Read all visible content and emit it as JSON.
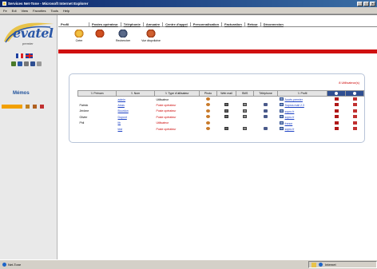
{
  "window": {
    "title": "Services Net-Tone - Microsoft Internet Explorer"
  },
  "menu": [
    "Fe",
    "Edi",
    "View",
    "Favorites",
    "Tools",
    "Help"
  ],
  "brand": {
    "logo_text": "evatel",
    "sub_text": "premier"
  },
  "sidebar": {
    "memos_title": "Mémos"
  },
  "nav": {
    "current": "Profil",
    "tabs": [
      "Postes opérateur",
      "Téléphonie",
      "Annuaire",
      "Centre d'appel",
      "Personnalisation",
      "Facturation",
      "Retour",
      "Déconnexion"
    ]
  },
  "toolbar": [
    {
      "label": "Créer",
      "icon": "create-icon"
    },
    {
      "label": "",
      "icon": "user-action-icon"
    },
    {
      "label": "Rechercher",
      "icon": "search-icon"
    },
    {
      "label": "Vue dtupvliotve",
      "icon": "view-icon"
    }
  ],
  "users_panel": {
    "count_text": "8 Utilisateur(s)",
    "columns": [
      "Prénom",
      "Nom",
      "Type d'utilisateur",
      "Photo",
      "Web mail",
      "SMS",
      "Téléphone",
      "Profil"
    ],
    "rows": [
      {
        "prenom": "",
        "nom": "admin",
        "type": "Utilisateur",
        "type_red": false,
        "has_mail": false,
        "has_sms": false,
        "has_tel": false,
        "profil": "Accès premier"
      },
      {
        "prenom": "Patrick",
        "nom": "Arras",
        "type": "Poste opérateur",
        "type_red": true,
        "has_mail": true,
        "has_sms": true,
        "has_tel": true,
        "profil": "Sopros mail 2.3"
      },
      {
        "prenom": "Jérôme",
        "nom": "Bourdon",
        "type": "Poste opérateur",
        "type_red": true,
        "has_mail": true,
        "has_sms": true,
        "has_tel": true,
        "profil": "sopro.fr"
      },
      {
        "prenom": "Olivier",
        "nom": "Dupont",
        "type": "Poste opérateur",
        "type_red": true,
        "has_mail": true,
        "has_sms": true,
        "has_tel": true,
        "profil": "sopro.fr"
      },
      {
        "prenom": "Phil",
        "nom": "lib",
        "type": "Utilisateur",
        "type_red": true,
        "has_mail": false,
        "has_sms": false,
        "has_tel": false,
        "profil": "france"
      },
      {
        "prenom": "",
        "nom": "test",
        "type": "Poste opérateur",
        "type_red": true,
        "has_mail": true,
        "has_sms": true,
        "has_tel": true,
        "profil": "sopro.fr"
      }
    ]
  },
  "status": {
    "left_text": "Net-Tone",
    "zone_text": "Internet"
  }
}
